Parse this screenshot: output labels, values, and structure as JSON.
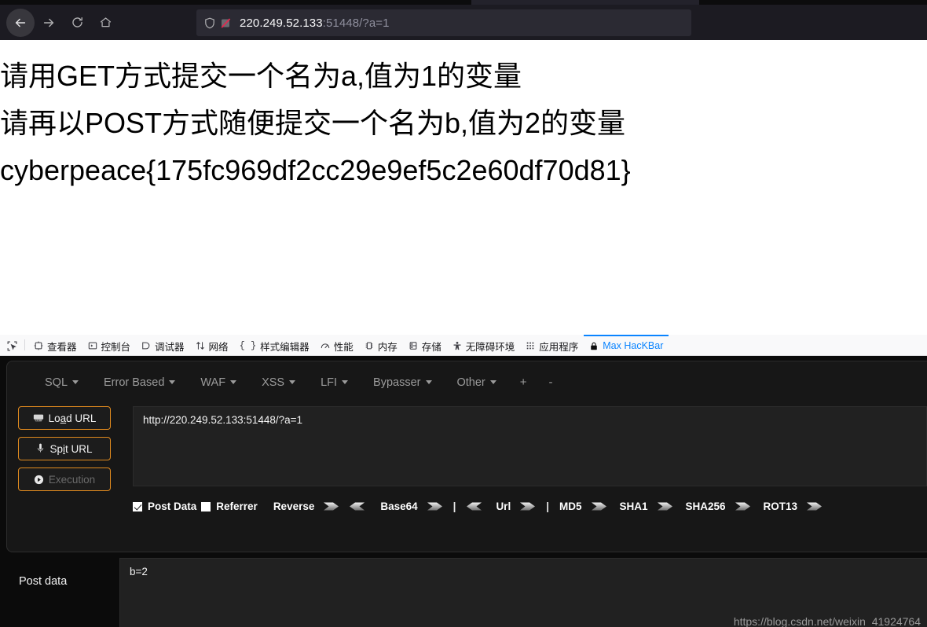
{
  "browser": {
    "nav": {
      "back": "back-arrow",
      "forward": "forward-arrow",
      "reload": "reload",
      "home": "home"
    },
    "urlbar": {
      "shield_icon": "shield-icon",
      "tracking_icon": "tracking-protection-off-icon",
      "host": "220.249.52.133",
      "rest": ":51448/?a=1",
      "full_url": "220.249.52.133:51448/?a=1"
    }
  },
  "page": {
    "lines": [
      "请用GET方式提交一个名为a,值为1的变量",
      "请再以POST方式随便提交一个名为b,值为2的变量",
      "cyberpeace{175fc969df2cc29e9ef5c2e60df70d81}"
    ]
  },
  "devtools": {
    "tabs": [
      {
        "label": "查看器",
        "icon": "inspector-icon",
        "active": false
      },
      {
        "label": "控制台",
        "icon": "console-icon",
        "active": false
      },
      {
        "label": "调试器",
        "icon": "debugger-icon",
        "active": false
      },
      {
        "label": "网络",
        "icon": "network-icon",
        "active": false
      },
      {
        "label": "样式编辑器",
        "icon": "style-editor-icon",
        "active": false
      },
      {
        "label": "性能",
        "icon": "performance-icon",
        "active": false
      },
      {
        "label": "内存",
        "icon": "memory-icon",
        "active": false
      },
      {
        "label": "存储",
        "icon": "storage-icon",
        "active": false
      },
      {
        "label": "无障碍环境",
        "icon": "accessibility-icon",
        "active": false
      },
      {
        "label": "应用程序",
        "icon": "application-icon",
        "active": false
      },
      {
        "label": "Max HacKBar",
        "icon": "lock-icon",
        "active": true
      }
    ],
    "picker_icon": "element-picker-icon"
  },
  "hackbar": {
    "menu": [
      {
        "label": "SQL",
        "caret": true
      },
      {
        "label": "Error Based",
        "caret": true
      },
      {
        "label": "WAF",
        "caret": true
      },
      {
        "label": "XSS",
        "caret": true
      },
      {
        "label": "LFI",
        "caret": true
      },
      {
        "label": "Bypasser",
        "caret": true
      },
      {
        "label": "Other",
        "caret": true
      }
    ],
    "add_label": "+",
    "remove_label": "-",
    "buttons": [
      {
        "name": "load-url",
        "pre": "Lo",
        "acc": "a",
        "post": "d URL",
        "icon": "load-url-icon",
        "disabled": false
      },
      {
        "name": "spit-url",
        "pre": "Sp",
        "acc": "i",
        "post": "t URL",
        "icon": "spit-url-icon",
        "disabled": false
      },
      {
        "name": "execution",
        "pre": "Execut",
        "acc": "",
        "post": "ion",
        "icon": "execution-icon",
        "disabled": true
      }
    ],
    "url_value": "http://220.249.52.133:51448/?a=1",
    "encoders": {
      "post_data": {
        "label": "Post Data",
        "checked": true
      },
      "referrer": {
        "label": "Referrer",
        "checked": false
      },
      "items": [
        {
          "label": "Reverse",
          "right": true,
          "left": true,
          "pipe_after": false
        },
        {
          "label": "Base64",
          "right": true,
          "left": true,
          "pipe_after": true
        },
        {
          "label": "Url",
          "right": true,
          "left": false,
          "pipe_after": true
        },
        {
          "label": "MD5",
          "right": true,
          "left": false,
          "pipe_after": false
        },
        {
          "label": "SHA1",
          "right": true,
          "left": false,
          "pipe_after": false
        },
        {
          "label": "SHA256",
          "right": true,
          "left": false,
          "pipe_after": false
        },
        {
          "label": "ROT13",
          "right": true,
          "left": false,
          "pipe_after": false
        }
      ]
    },
    "post_label": "Post data",
    "post_value": "b=2"
  },
  "watermark": "https://blog.csdn.net/weixin_41924764"
}
